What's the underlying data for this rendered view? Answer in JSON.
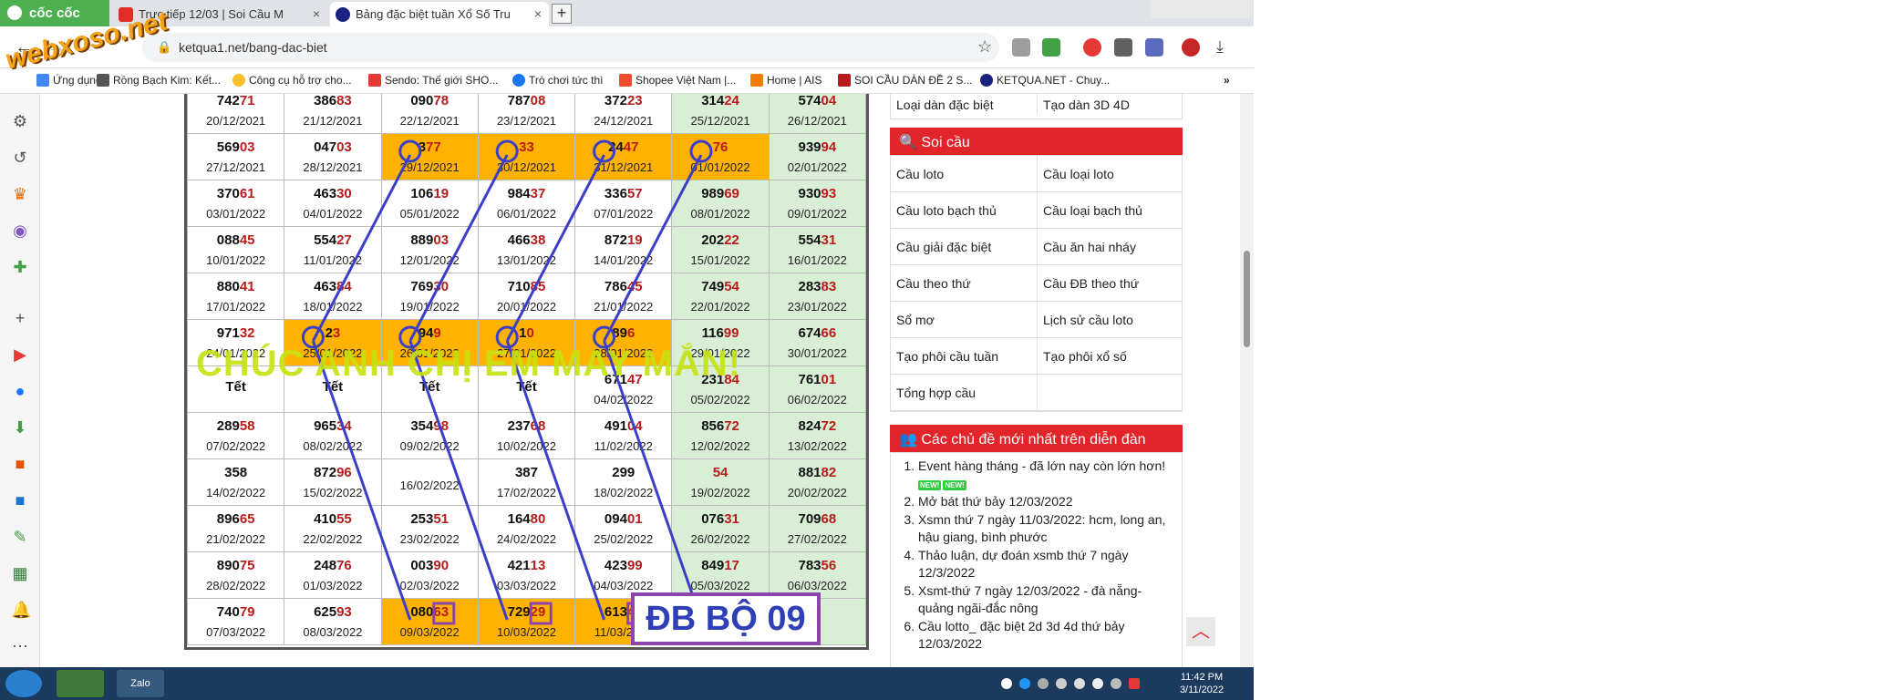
{
  "browser": {
    "logo": "cốc cốc",
    "tabs": [
      {
        "label": "Trực tiếp 12/03 | Soi Cầu M"
      },
      {
        "label": "Bảng đặc biệt tuần Xổ Số Tru"
      }
    ],
    "url": "ketqua1.net/bang-dac-biet",
    "bookmarks": [
      "Ứng dụng",
      "Rồng Bạch Kim: Kết...",
      "Công cụ hỗ trợ cho...",
      "Sendo: Thế giới SHO...",
      "Trò chơi tức thì",
      "Shopee Việt Nam |...",
      "Home | AIS",
      "SOI CẦU DÀN ĐỀ 2 S...",
      "KETQUA.NET - Chuy..."
    ],
    "accent": "#4caf50"
  },
  "watermark": "webxoso.net",
  "table": {
    "rows": [
      [
        {
          "n": "742",
          "h": "71",
          "d": "20/12/2021"
        },
        {
          "n": "386",
          "h": "83",
          "d": "21/12/2021"
        },
        {
          "n": "090",
          "h": "78",
          "d": "22/12/2021"
        },
        {
          "n": "787",
          "h": "08",
          "d": "23/12/2021"
        },
        {
          "n": "372",
          "h": "23",
          "d": "24/12/2021"
        },
        {
          "n": "314",
          "h": "24",
          "d": "25/12/2021",
          "c": "green"
        },
        {
          "n": "574",
          "h": "04",
          "d": "26/12/2021",
          "c": "green"
        }
      ],
      [
        {
          "n": "569",
          "h": "03",
          "d": "27/12/2021"
        },
        {
          "n": "047",
          "h": "03",
          "d": "28/12/2021"
        },
        {
          "n": "3",
          "h": "77",
          "d": "29/12/2021",
          "c": "orange"
        },
        {
          "n": "",
          "h": "33",
          "d": "30/12/2021",
          "c": "orange"
        },
        {
          "n": "24",
          "h": "47",
          "d": "31/12/2021",
          "c": "orange"
        },
        {
          "n": "",
          "h": "76",
          "d": "01/01/2022",
          "c": "orange"
        },
        {
          "n": "939",
          "h": "94",
          "d": "02/01/2022",
          "c": "green"
        }
      ],
      [
        {
          "n": "370",
          "h": "61",
          "d": "03/01/2022"
        },
        {
          "n": "463",
          "h": "30",
          "d": "04/01/2022"
        },
        {
          "n": "106",
          "h": "19",
          "d": "05/01/2022"
        },
        {
          "n": "984",
          "h": "37",
          "d": "06/01/2022"
        },
        {
          "n": "336",
          "h": "57",
          "d": "07/01/2022"
        },
        {
          "n": "989",
          "h": "69",
          "d": "08/01/2022",
          "c": "green"
        },
        {
          "n": "930",
          "h": "93",
          "d": "09/01/2022",
          "c": "green"
        }
      ],
      [
        {
          "n": "088",
          "h": "45",
          "d": "10/01/2022"
        },
        {
          "n": "554",
          "h": "27",
          "d": "11/01/2022"
        },
        {
          "n": "889",
          "h": "03",
          "d": "12/01/2022"
        },
        {
          "n": "466",
          "h": "38",
          "d": "13/01/2022"
        },
        {
          "n": "872",
          "h": "19",
          "d": "14/01/2022"
        },
        {
          "n": "202",
          "h": "22",
          "d": "15/01/2022",
          "c": "green"
        },
        {
          "n": "554",
          "h": "31",
          "d": "16/01/2022",
          "c": "green"
        }
      ],
      [
        {
          "n": "880",
          "h": "41",
          "d": "17/01/2022"
        },
        {
          "n": "463",
          "h": "84",
          "d": "18/01/2022"
        },
        {
          "n": "769",
          "h": "30",
          "d": "19/01/2022"
        },
        {
          "n": "710",
          "h": "85",
          "d": "20/01/2022"
        },
        {
          "n": "786",
          "h": "45",
          "d": "21/01/2022"
        },
        {
          "n": "749",
          "h": "54",
          "d": "22/01/2022",
          "c": "green"
        },
        {
          "n": "283",
          "h": "83",
          "d": "23/01/2022",
          "c": "green"
        }
      ],
      [
        {
          "n": "971",
          "h": "32",
          "d": "24/01/2022"
        },
        {
          "n": "2",
          "h": "3",
          "d": "25/01/2022",
          "c": "orange"
        },
        {
          "n": "94",
          "h": "9",
          "d": "26/01/2022",
          "c": "orange"
        },
        {
          "n": "1",
          "h": "0",
          "d": "27/01/2022",
          "c": "orange"
        },
        {
          "n": "89",
          "h": "6",
          "d": "28/01/2022",
          "c": "orange"
        },
        {
          "n": "116",
          "h": "99",
          "d": "29/01/2022",
          "c": "green"
        },
        {
          "n": "674",
          "h": "66",
          "d": "30/01/2022",
          "c": "green"
        }
      ],
      [
        {
          "n": "Tết",
          "h": "",
          "d": "",
          "c": "tet"
        },
        {
          "n": "Tết",
          "h": "",
          "d": "",
          "c": "tet"
        },
        {
          "n": "Tết",
          "h": "",
          "d": "",
          "c": "tet"
        },
        {
          "n": "Tết",
          "h": "",
          "d": "",
          "c": "tet"
        },
        {
          "n": "671",
          "h": "47",
          "d": "04/02/2022"
        },
        {
          "n": "231",
          "h": "84",
          "d": "05/02/2022",
          "c": "green"
        },
        {
          "n": "761",
          "h": "01",
          "d": "06/02/2022",
          "c": "green"
        }
      ],
      [
        {
          "n": "289",
          "h": "58",
          "d": "07/02/2022"
        },
        {
          "n": "965",
          "h": "34",
          "d": "08/02/2022"
        },
        {
          "n": "354",
          "h": "98",
          "d": "09/02/2022"
        },
        {
          "n": "237",
          "h": "68",
          "d": "10/02/2022"
        },
        {
          "n": "491",
          "h": "04",
          "d": "11/02/2022"
        },
        {
          "n": "856",
          "h": "72",
          "d": "12/02/2022",
          "c": "green"
        },
        {
          "n": "824",
          "h": "72",
          "d": "13/02/2022",
          "c": "green"
        }
      ],
      [
        {
          "n": "358",
          "h": "",
          "d": "14/02/2022"
        },
        {
          "n": "872",
          "h": "96",
          "d": "15/02/2022"
        },
        {
          "n": "",
          "h": "",
          "d": "16/02/2022"
        },
        {
          "n": "387",
          "h": "",
          "d": "17/02/2022"
        },
        {
          "n": "299",
          "h": "",
          "d": "18/02/2022"
        },
        {
          "n": "",
          "h": "54",
          "d": "19/02/2022",
          "c": "green"
        },
        {
          "n": "881",
          "h": "82",
          "d": "20/02/2022",
          "c": "green"
        }
      ],
      [
        {
          "n": "896",
          "h": "65",
          "d": "21/02/2022"
        },
        {
          "n": "410",
          "h": "55",
          "d": "22/02/2022"
        },
        {
          "n": "253",
          "h": "51",
          "d": "23/02/2022"
        },
        {
          "n": "164",
          "h": "80",
          "d": "24/02/2022"
        },
        {
          "n": "094",
          "h": "01",
          "d": "25/02/2022"
        },
        {
          "n": "076",
          "h": "31",
          "d": "26/02/2022",
          "c": "green"
        },
        {
          "n": "709",
          "h": "68",
          "d": "27/02/2022",
          "c": "green"
        }
      ],
      [
        {
          "n": "890",
          "h": "75",
          "d": "28/02/2022"
        },
        {
          "n": "248",
          "h": "76",
          "d": "01/03/2022"
        },
        {
          "n": "003",
          "h": "90",
          "d": "02/03/2022"
        },
        {
          "n": "421",
          "h": "13",
          "d": "03/03/2022"
        },
        {
          "n": "423",
          "h": "99",
          "d": "04/03/2022"
        },
        {
          "n": "849",
          "h": "17",
          "d": "05/03/2022",
          "c": "green"
        },
        {
          "n": "783",
          "h": "56",
          "d": "06/03/2022",
          "c": "green"
        }
      ],
      [
        {
          "n": "740",
          "h": "79",
          "d": "07/03/2022"
        },
        {
          "n": "625",
          "h": "93",
          "d": "08/03/2022"
        },
        {
          "n": "080",
          "h": "63",
          "d": "09/03/2022",
          "c": "orange"
        },
        {
          "n": "729",
          "h": "29",
          "d": "10/03/2022",
          "c": "orange"
        },
        {
          "n": "613",
          "h": "49",
          "d": "11/03/2022",
          "c": "orange"
        },
        {
          "n": "",
          "h": "",
          "d": "",
          "c": "green"
        },
        {
          "n": "",
          "h": "",
          "d": "",
          "c": "green"
        }
      ]
    ]
  },
  "greeting": "CHÚC ANH CHỊ EM MAY MẮN!",
  "result_box": "ĐB BỘ 09",
  "right_panel": {
    "top_links": [
      "Loại dàn đặc biệt",
      "Tạo dàn 3D 4D"
    ],
    "soicau_title": "Soi cầu",
    "soicau_links": [
      "Cầu loto",
      "Cầu loại loto",
      "Cầu loto bạch thủ",
      "Cầu loại bạch thủ",
      "Cầu giải đặc biệt",
      "Cầu ăn hai nháy",
      "Cầu theo thứ",
      "Cầu ĐB theo thứ",
      "Sổ mơ",
      "Lịch sử cầu loto",
      "Tạo phôi cầu tuần",
      "Tạo phôi xổ số",
      "Tổng hợp cầu",
      ""
    ],
    "forum_title": "Các chủ đề mới nhất trên diễn đàn",
    "new_badge": "NEW!",
    "forum_items": [
      "Event hàng tháng - đã lớn nay còn lớn hơn!",
      "Mở bát thứ bảy 12/03/2022",
      "Xsmn thứ 7 ngày 11/03/2022: hcm, long an, hậu giang, bình phước",
      "Thảo luận, dự đoán xsmb thứ 7 ngày 12/3/2022",
      "Xsmt-thứ 7 ngày 12/03/2022 - đà nẵng-quảng ngãi-đắc nông",
      "Cầu lotto_ đặc biệt 2d 3d 4d thứ bảy 12/03/2022"
    ]
  },
  "taskbar": {
    "app": "Zalo",
    "time": "11:42 PM",
    "date": "3/11/2022"
  }
}
